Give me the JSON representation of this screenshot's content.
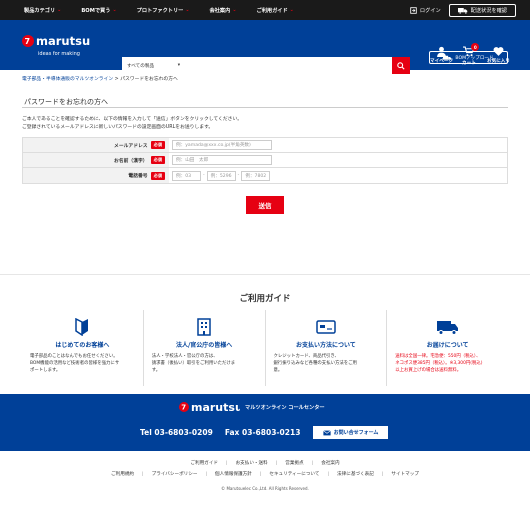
{
  "topbar": {
    "nav": [
      "製品カテゴリ",
      "BOMで買う",
      "プロトファクトリー",
      "会社案内",
      "ご利用ガイド"
    ],
    "login": "ログイン",
    "shipping": "配送状況を確認"
  },
  "header": {
    "logo_text": "marutsu",
    "logo_tag": "ideas for making",
    "search_category": "すべての製品",
    "icons": {
      "mypage": "マイページ",
      "cart": "カート",
      "cart_count": "0",
      "favorites": "お気に入り"
    },
    "bom_upload": "BOMアップロード"
  },
  "breadcrumb": {
    "part1": "電子部品・半導体通販のマルツオンライン",
    "sep": " > ",
    "current": "パスワードをお忘れの方へ"
  },
  "page_title": "パスワードをお忘れの方へ",
  "desc": {
    "line1": "ご本人であることを確認するために、以下の情報を入力して「送信」ボタンをクリックしてください。",
    "line2": "ご登録されているメールアドレスに新しいパスワードの設定画面のURLをお送りします。"
  },
  "form": {
    "required": "必須",
    "email_label": "メールアドレス",
    "email_ph": "例：yamada@xxx.co.jp(半角英数)",
    "name_label": "お名前（漢字）",
    "name_ph": "例：山田　太郎",
    "phone_label": "電話番号",
    "phone_ph1": "例：03",
    "phone_ph2": "例：5296",
    "phone_ph3": "例：7802",
    "dash": "-",
    "submit": "送信"
  },
  "guide": {
    "title": "ご利用ガイド",
    "cards": [
      {
        "title": "はじめてのお客様へ",
        "l1": "電子部品のことはなんでもお任せください。",
        "l2": "BOM機能の活用など技術者の皆様を強力にサ",
        "l3": "ポートします。"
      },
      {
        "title": "法人/官公庁の皆様へ",
        "l1": "法人・学校法人・官公庁の方は、",
        "l2": "請求書（後払い）取引をご利用いただけま",
        "l3": "す。"
      },
      {
        "title": "お支払い方法について",
        "l1": "クレジットカード、商品代引き、",
        "l2": "銀行振り込みなど各種の支払い方法をご用",
        "l3": "意。"
      },
      {
        "title": "お届けについて",
        "l1": "送料は全国一律。宅急便：550円（税込）、",
        "l2": "ネコポス便385円（税込）。※3,300円(税込)",
        "l3": "以上お買上げの場合は送料無料。"
      }
    ]
  },
  "contact": {
    "brand": "marutsu",
    "center": "マルツオンライン コールセンター",
    "tel": "Tel 03-6803-0209",
    "fax": "Fax 03-6803-0213",
    "inquiry": "お問い合せフォーム"
  },
  "footer": {
    "links1": [
      "ご利用ガイド",
      "お支払い・送料",
      "営業拠点",
      "会社案内"
    ],
    "links2": [
      "ご利用規約",
      "プライバシーポリシー",
      "個人情報保護方針",
      "セキュリティーについて",
      "法律に基づく表記",
      "サイトマップ"
    ],
    "copyright": "© Marutsuelec Co.,Ltd. All Rights Reserved."
  },
  "colors": {
    "brand_blue": "#004098",
    "accent_red": "#e60012",
    "topbar": "#1a1a1a"
  }
}
